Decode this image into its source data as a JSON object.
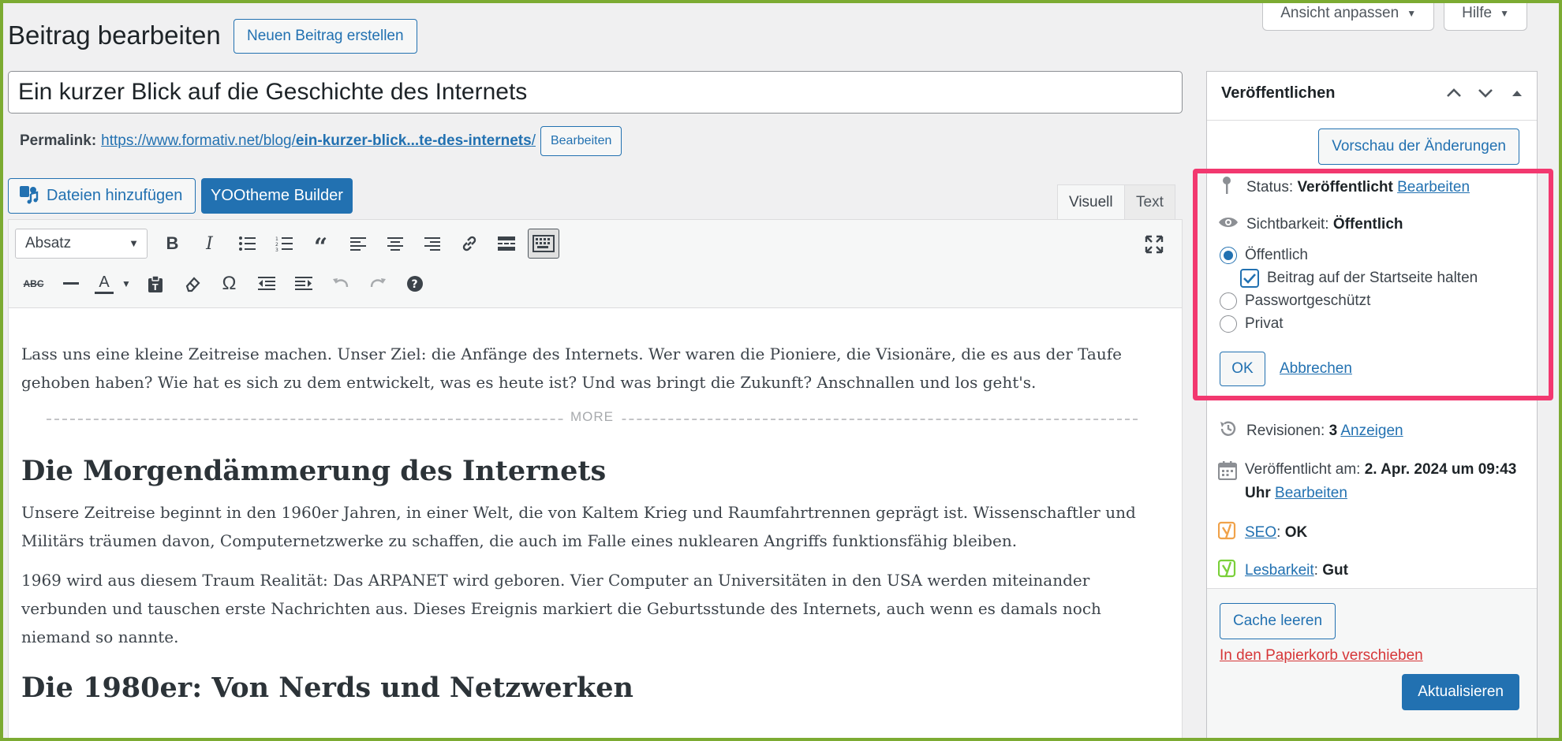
{
  "screen_options": {
    "view_label": "Ansicht anpassen",
    "help_label": "Hilfe"
  },
  "header": {
    "title": "Beitrag bearbeiten",
    "new_post_label": "Neuen Beitrag erstellen"
  },
  "post": {
    "title": "Ein kurzer Blick auf die Geschichte des Internets",
    "permalink_label": "Permalink:",
    "permalink_base": "https://www.formativ.net/blog/",
    "permalink_slug": "ein-kurzer-blick...te-des-internets",
    "permalink_trailing": "/",
    "permalink_edit_label": "Bearbeiten"
  },
  "media": {
    "add_media_label": "Dateien hinzufügen",
    "yootheme_label": "YOOtheme Builder"
  },
  "editor_tabs": {
    "visual": "Visuell",
    "text": "Text"
  },
  "toolbar": {
    "format_select": "Absatz",
    "row1_icons": [
      "bold-icon",
      "italic-icon",
      "bulleted-list-icon",
      "numbered-list-icon",
      "blockquote-icon",
      "align-left-icon",
      "align-center-icon",
      "align-right-icon",
      "link-icon",
      "read-more-icon",
      "toolbar-toggle-icon"
    ],
    "row2_icons": [
      "strikethrough-icon",
      "horizontal-line-icon",
      "text-color-icon",
      "paste-as-text-icon",
      "clear-formatting-icon",
      "special-character-icon",
      "outdent-icon",
      "indent-icon",
      "undo-icon",
      "redo-icon",
      "help-icon"
    ]
  },
  "content": {
    "intro": "Lass uns eine kleine Zeitreise machen. Unser Ziel: die Anfänge des Internets. Wer waren die Pioniere, die Visionäre, die es aus der Taufe gehoben haben? Wie hat es sich zu dem entwickelt, was es heute ist? Und was bringt die Zukunft? Anschnallen und los geht's.",
    "more_label": "MORE",
    "h1": "Die Morgendämmerung des Internets",
    "p1": "Unsere Zeitreise beginnt in den 1960er Jahren, in einer Welt, die von Kaltem Krieg und Raumfahrtrennen geprägt ist. Wissenschaftler und Militärs träumen davon, Computernetzwerke zu schaffen, die auch im Falle eines nuklearen Angriffs funktionsfähig bleiben.",
    "p2": "1969 wird aus diesem Traum Realität: Das ARPANET wird geboren. Vier Computer an Universitäten in den USA werden miteinander verbunden und tauschen erste Nachrichten aus. Dieses Ereignis markiert die Geburtsstunde des Internets, auch wenn es damals noch niemand so nannte.",
    "h2": "Die 1980er: Von Nerds und Netzwerken"
  },
  "publish": {
    "title": "Veröffentlichen",
    "preview_label": "Vorschau der Änderungen",
    "status_label": "Status:",
    "status_value": "Veröffentlicht",
    "status_edit": "Bearbeiten",
    "visibility_label": "Sichtbarkeit:",
    "visibility_value": "Öffentlich",
    "options": {
      "public": "Öffentlich",
      "sticky": "Beitrag auf der Startseite halten",
      "password": "Passwortgeschützt",
      "private": "Privat"
    },
    "ok_label": "OK",
    "cancel_label": "Abbrechen",
    "revisions_label": "Revisionen:",
    "revisions_count": "3",
    "revisions_link": "Anzeigen",
    "published_label": "Veröffentlicht am:",
    "published_value": "2. Apr. 2024 um 09:43 Uhr",
    "published_edit": "Bearbeiten",
    "seo_label": "SEO",
    "seo_value": "OK",
    "readability_label": "Lesbarkeit",
    "readability_value": "Gut",
    "cache_label": "Cache leeren",
    "trash_label": "In den Papierkorb verschieben",
    "update_label": "Aktualisieren"
  },
  "colors": {
    "frame": "#7cab32",
    "accent": "#2271b1",
    "highlight": "#f2386f",
    "trash": "#d63638",
    "seo_orange": "#f0a24a",
    "readability_green": "#7ad03a"
  }
}
